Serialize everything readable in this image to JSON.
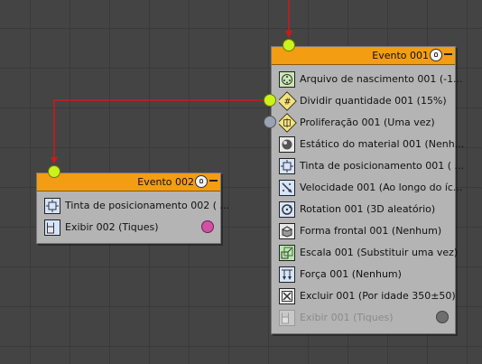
{
  "event1": {
    "title": "Evento 001",
    "operators": [
      {
        "label": "Arquivo de nascimento 001 (-1...",
        "icon": "birth-file-icon"
      },
      {
        "label": "Dividir quantidade 001 (15%)",
        "icon": "split-amount-icon"
      },
      {
        "label": "Proliferação 001 (Uma vez)",
        "icon": "spawn-icon"
      },
      {
        "label": "Estático do material 001 (Nenh...",
        "icon": "material-static-icon"
      },
      {
        "label": "Tinta de posicionamento 001 ( ...",
        "icon": "position-icon"
      },
      {
        "label": "Velocidade 001 (Ao longo do íc...",
        "icon": "speed-icon"
      },
      {
        "label": "Rotation 001 (3D aleatório)",
        "icon": "rotation-icon"
      },
      {
        "label": "Forma frontal 001 (Nenhum)",
        "icon": "shape-facing-icon"
      },
      {
        "label": "Escala 001 (Substituir uma vez)",
        "icon": "scale-icon"
      },
      {
        "label": "Força 001 (Nenhum)",
        "icon": "force-icon"
      },
      {
        "label": "Excluir 001 (Por idade 350±50)",
        "icon": "delete-icon"
      },
      {
        "label": "Exibir 001 (Tiques)",
        "icon": "display-icon",
        "disabled": true
      }
    ],
    "display_color": "#6e6e6e"
  },
  "event2": {
    "title": "Evento 002",
    "operators": [
      {
        "label": "Tinta de posicionamento 002 ( ...",
        "icon": "position-icon"
      },
      {
        "label": "Exibir 002 (Tiques)",
        "icon": "display-icon"
      }
    ],
    "display_color": "#d44fa6"
  },
  "colors": {
    "header": "#f29d12",
    "node_body": "#b4b4b4",
    "wire": "#d01818",
    "input_connector": "#ccf21a",
    "output_connector_active": "#ccf21a",
    "output_connector_idle": "#9aa3b3"
  }
}
